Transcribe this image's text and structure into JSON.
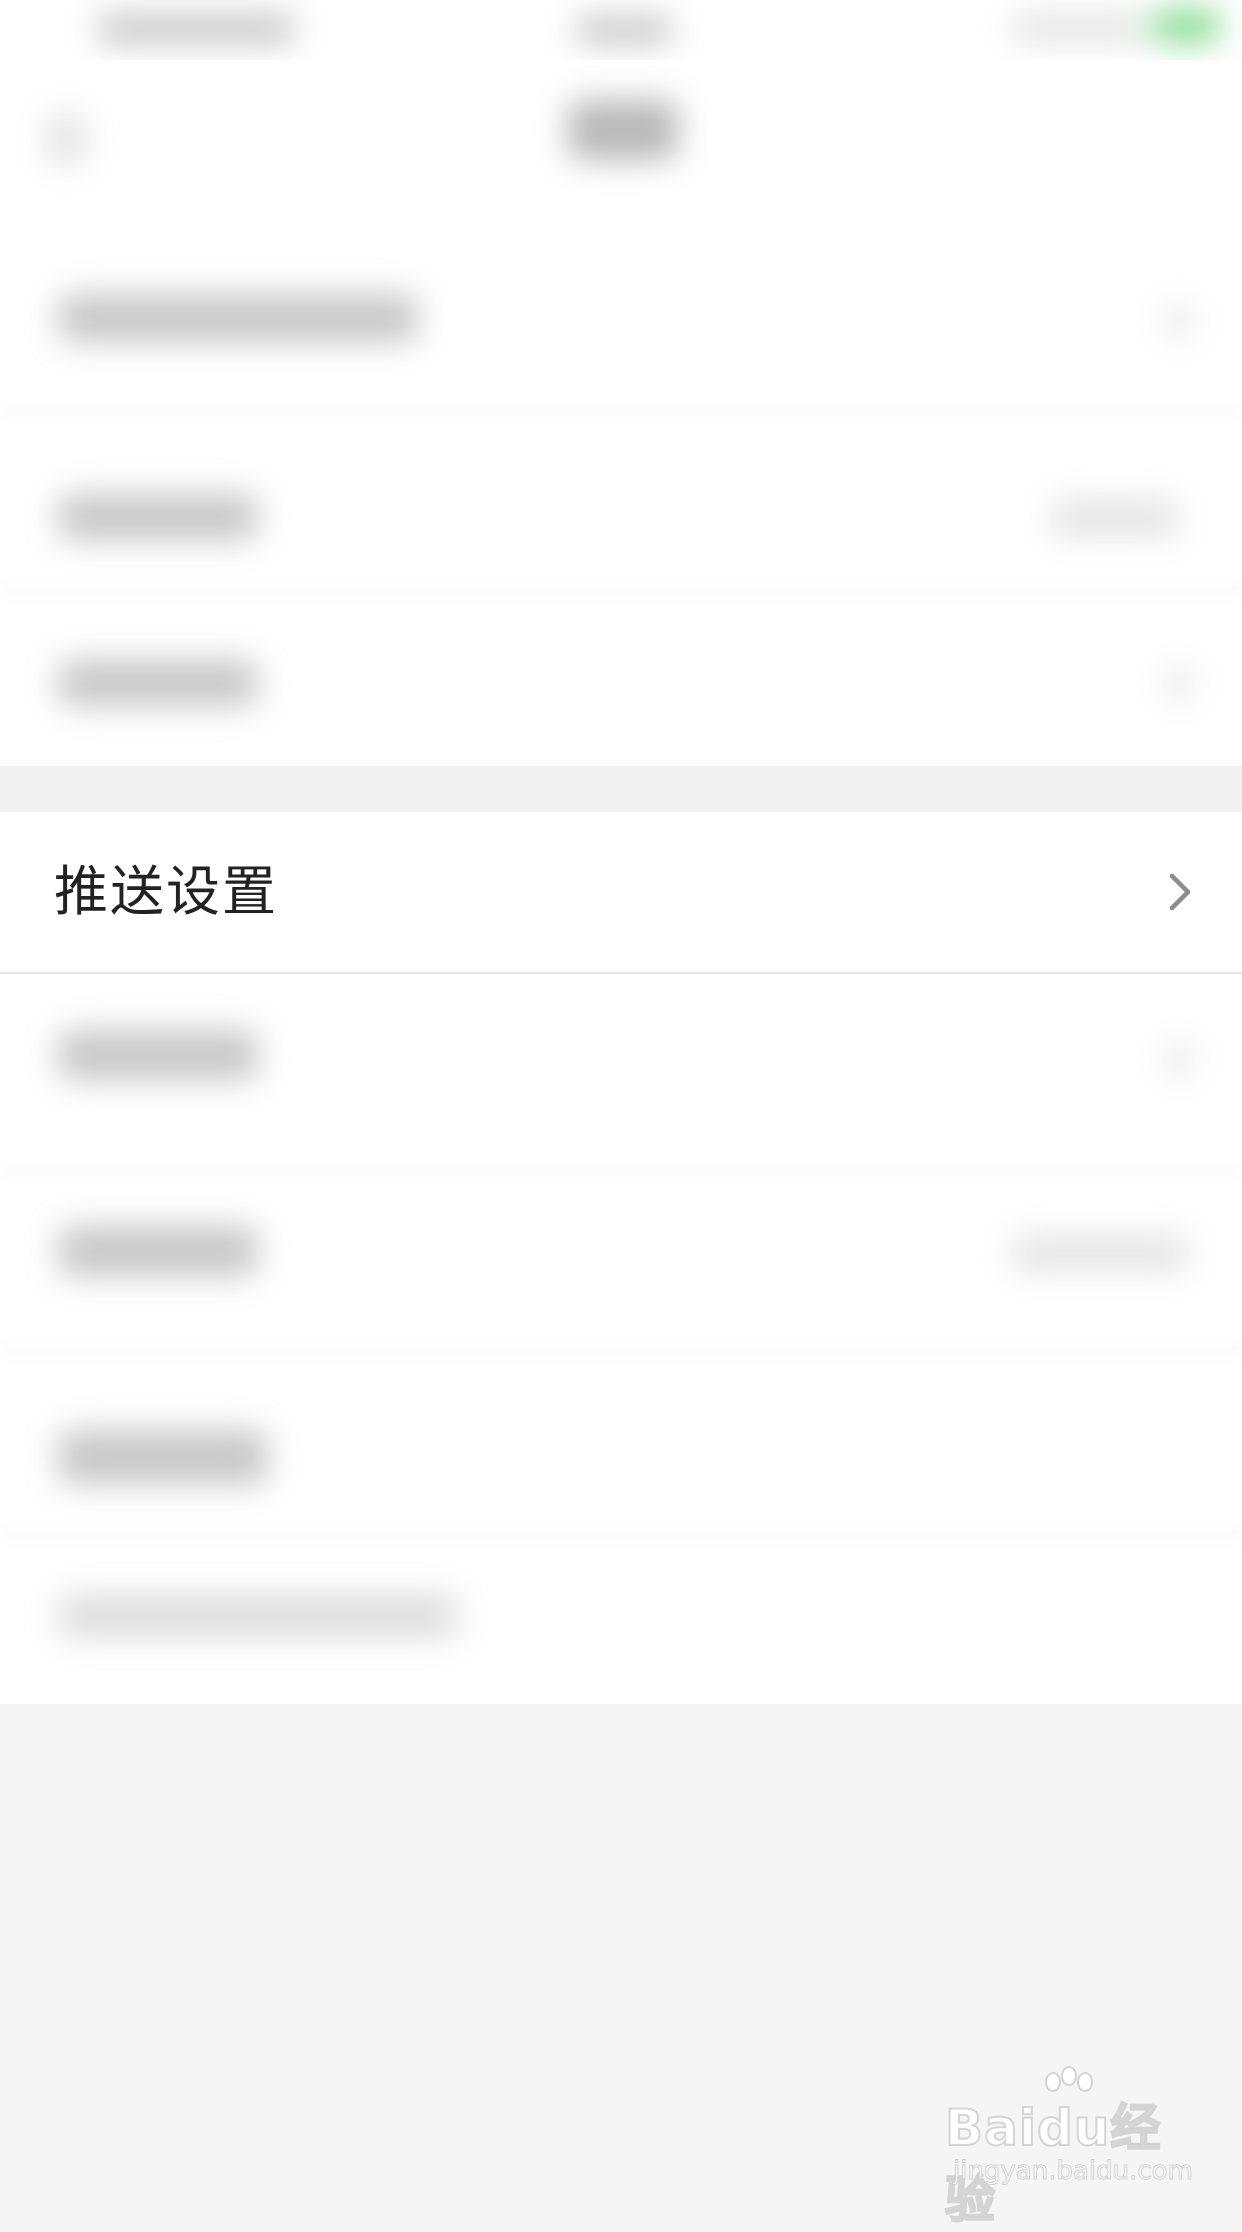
{
  "settings": {
    "push_settings": {
      "label": "推送设置",
      "chevron_icon": "chevron-right-icon"
    }
  },
  "watermark": {
    "logo": "Baidu经验",
    "url": "jingyan.baidu.com"
  },
  "colors": {
    "background": "#f5f5f5",
    "row_background": "#ffffff",
    "text": "#222222",
    "chevron": "#8c8c8c",
    "status_battery": "#5fcf6f"
  }
}
